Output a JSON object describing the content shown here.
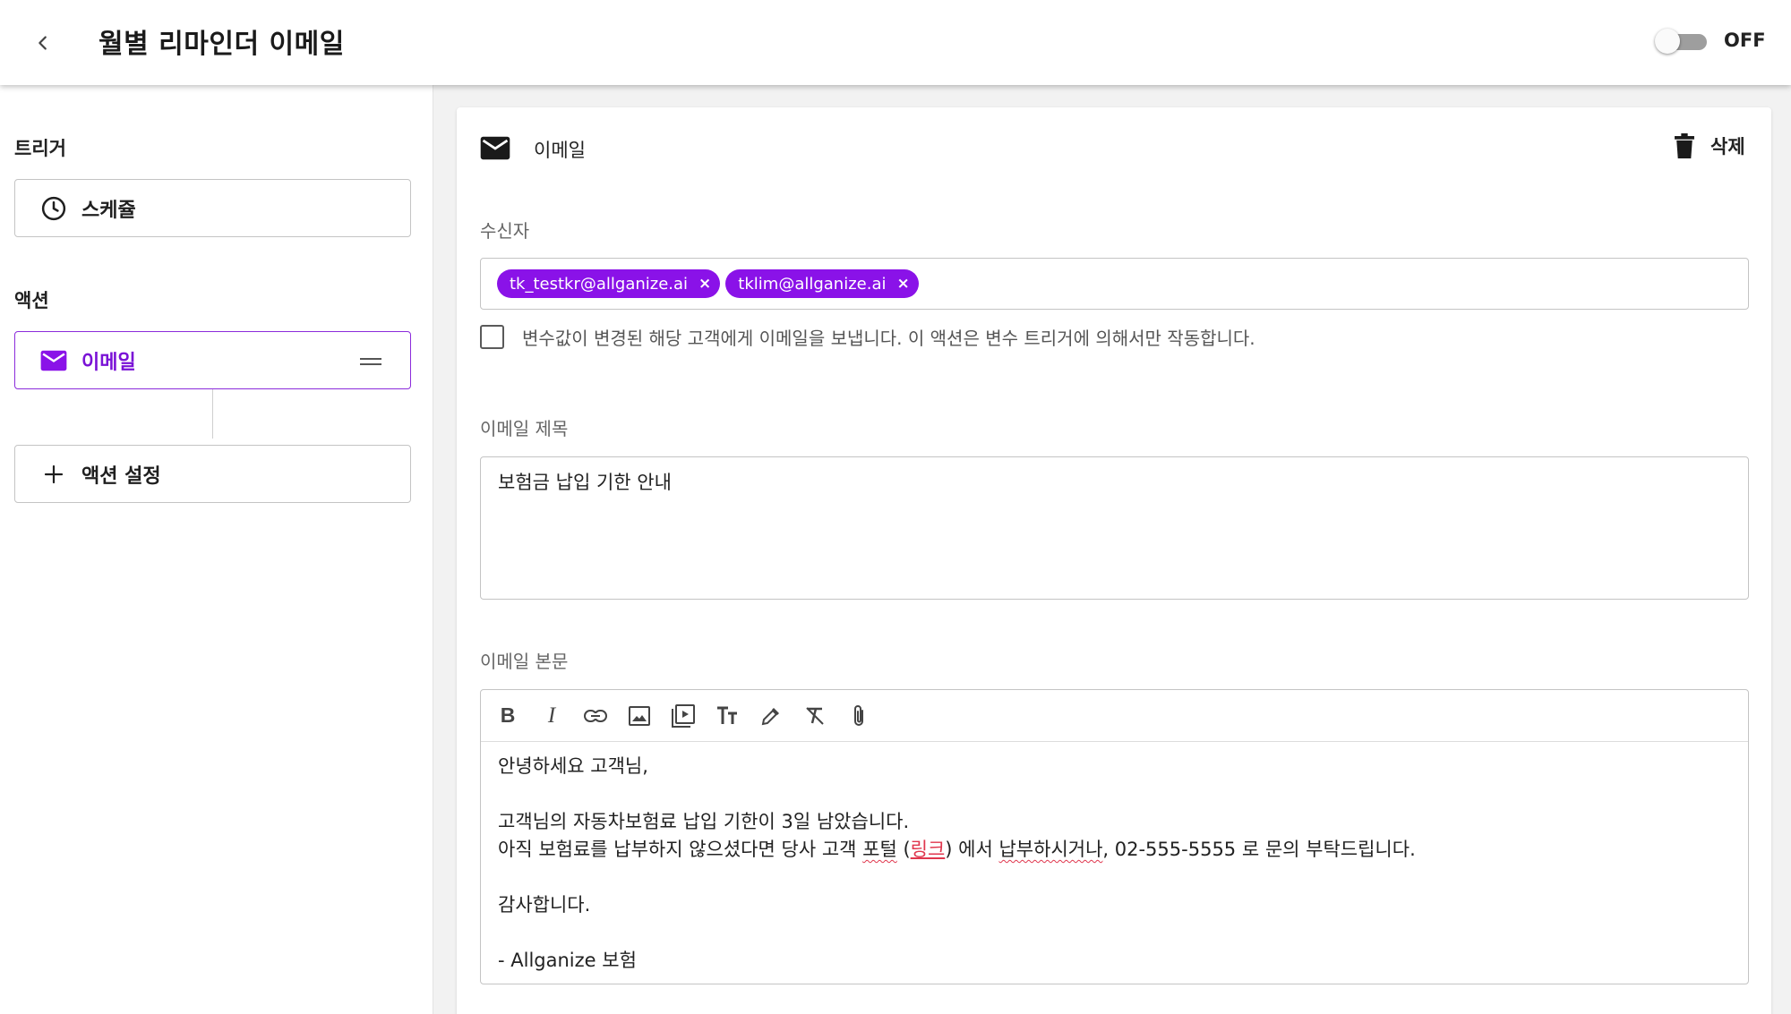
{
  "header": {
    "title": "월별 리마인더 이메일",
    "toggle_label": "OFF",
    "toggle_on": false
  },
  "sidebar": {
    "trigger_label": "트리거",
    "trigger_item": "스케쥴",
    "action_label": "액션",
    "action_item": "이메일",
    "add_action": "액션 설정"
  },
  "card": {
    "title": "이메일",
    "delete_label": "삭제"
  },
  "recipients": {
    "label": "수신자",
    "chips": [
      "tk_testkr@allganize.ai",
      "tklim@allganize.ai"
    ],
    "checkbox_label": "변수값이 변경된 해당 고객에게 이메일을 보냅니다. 이 액션은 변수 트리거에 의해서만 작동합니다.",
    "checkbox_checked": false
  },
  "subject": {
    "label": "이메일 제목",
    "value": "보험금 납입 기한 안내"
  },
  "body": {
    "label": "이메일 본문",
    "toolbar": [
      "bold-icon",
      "italic-icon",
      "link-icon",
      "image-icon",
      "video-icon",
      "text-size-icon",
      "color-picker-icon",
      "clear-format-icon",
      "attachment-icon"
    ],
    "line1": "안녕하세요 고객님,",
    "line2": "고객님의 자동차보험료 납입 기한이 3일 남았습니다.",
    "line3_a": "아직 보험료를 납부하지 않으셨다면 당사 고객 ",
    "line3_b": "포털",
    "line3_c": " (",
    "line3_link": "링크",
    "line3_d": ") 에서 ",
    "line3_e": "납부하시거나",
    "line3_f": ", 02-555-5555 로 문의 부탁드립니다.",
    "line4": "감사합니다.",
    "line5": "- Allganize 보험"
  },
  "colors": {
    "accent": "#8a12e8",
    "link": "#e0364d"
  }
}
